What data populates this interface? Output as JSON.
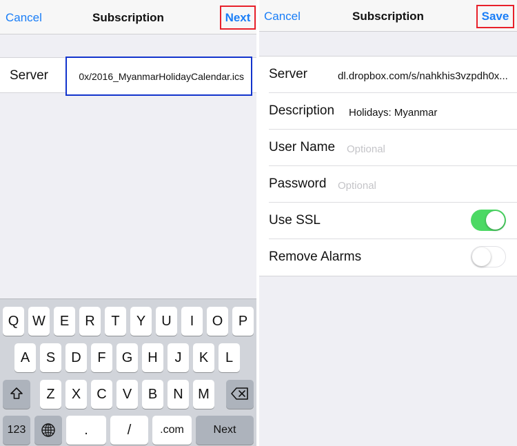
{
  "left": {
    "navbar": {
      "cancel": "Cancel",
      "title": "Subscription",
      "action": "Next"
    },
    "server": {
      "label": "Server",
      "value": "0x/2016_MyanmarHolidayCalendar.ics"
    },
    "keyboard": {
      "row1": [
        "Q",
        "W",
        "E",
        "R",
        "T",
        "Y",
        "U",
        "I",
        "O",
        "P"
      ],
      "row2": [
        "A",
        "S",
        "D",
        "F",
        "G",
        "H",
        "J",
        "K",
        "L"
      ],
      "row3": [
        "Z",
        "X",
        "C",
        "V",
        "B",
        "N",
        "M"
      ],
      "numbers": "123",
      "dot": ".",
      "slash": "/",
      "dotcom": ".com",
      "next": "Next",
      "shift_icon": "shift-arrow-icon",
      "globe_icon": "globe-icon",
      "delete_icon": "backspace-icon"
    }
  },
  "right": {
    "navbar": {
      "cancel": "Cancel",
      "title": "Subscription",
      "action": "Save"
    },
    "server": {
      "label": "Server",
      "value": "dl.dropbox.com/s/nahkhis3vzpdh0x..."
    },
    "description": {
      "label": "Description",
      "value": "Holidays: Myanmar"
    },
    "username": {
      "label": "User Name",
      "placeholder": "Optional"
    },
    "password": {
      "label": "Password",
      "placeholder": "Optional"
    },
    "use_ssl": {
      "label": "Use SSL",
      "on": true
    },
    "remove_alarms": {
      "label": "Remove Alarms",
      "on": false
    }
  },
  "colors": {
    "accent": "#1a7ef7",
    "highlight_red": "#e8202a",
    "highlight_blue": "#1133cc",
    "toggle_on": "#4cd964"
  }
}
